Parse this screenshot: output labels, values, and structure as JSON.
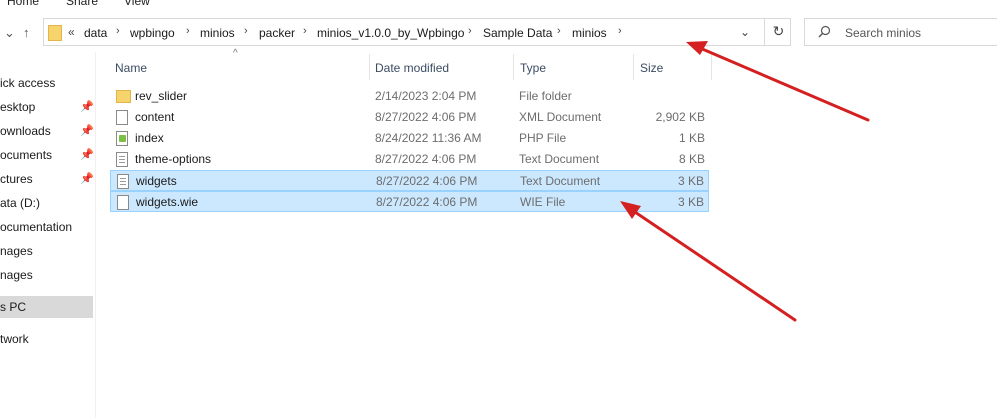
{
  "ribbon": {
    "tabs": [
      "Home",
      "Share",
      "View"
    ]
  },
  "nav": {
    "back_glyph": "‹",
    "up_glyph": "↑",
    "crumb_more": "«",
    "breadcrumb": [
      "data",
      "wpbingo",
      "minios",
      "packer",
      "minios_v1.0.0_by_Wpbingo",
      "Sample Data",
      "minios"
    ],
    "dropdown_glyph": "⌄",
    "refresh_glyph": "↻"
  },
  "search": {
    "placeholder": "Search minios",
    "icon": "search-icon"
  },
  "sidebar": {
    "items": [
      {
        "label": "ick access",
        "pinned": false
      },
      {
        "label": "esktop",
        "pinned": true
      },
      {
        "label": "ownloads",
        "pinned": true
      },
      {
        "label": "ocuments",
        "pinned": true
      },
      {
        "label": "ctures",
        "pinned": true
      },
      {
        "label": "ata (D:)",
        "pinned": false
      },
      {
        "label": "ocumentation",
        "pinned": false
      },
      {
        "label": "nages",
        "pinned": false
      },
      {
        "label": "nages",
        "pinned": false
      },
      {
        "label": "s PC",
        "pinned": false,
        "selected": true
      },
      {
        "label": "twork",
        "pinned": false
      }
    ]
  },
  "columns": {
    "name": "Name",
    "date": "Date modified",
    "type": "Type",
    "size": "Size"
  },
  "files": [
    {
      "name": "rev_slider",
      "date": "2/14/2023 2:04 PM",
      "type": "File folder",
      "size": "",
      "icon": "folder-icon",
      "selected": false
    },
    {
      "name": "content",
      "date": "8/27/2022 4:06 PM",
      "type": "XML Document",
      "size": "2,902 KB",
      "icon": "xml-file-icon",
      "selected": false
    },
    {
      "name": "index",
      "date": "8/24/2022 11:36 AM",
      "type": "PHP File",
      "size": "1 KB",
      "icon": "php-file-icon",
      "selected": false
    },
    {
      "name": "theme-options",
      "date": "8/27/2022 4:06 PM",
      "type": "Text Document",
      "size": "8 KB",
      "icon": "text-file-icon",
      "selected": false
    },
    {
      "name": "widgets",
      "date": "8/27/2022 4:06 PM",
      "type": "Text Document",
      "size": "3 KB",
      "icon": "text-file-icon",
      "selected": true
    },
    {
      "name": "widgets.wie",
      "date": "8/27/2022 4:06 PM",
      "type": "WIE File",
      "size": "3 KB",
      "icon": "file-icon",
      "selected": true
    }
  ],
  "colors": {
    "selection_bg": "#cce8ff",
    "selection_border": "#99d1ff",
    "annotation_arrow": "#d42020"
  }
}
